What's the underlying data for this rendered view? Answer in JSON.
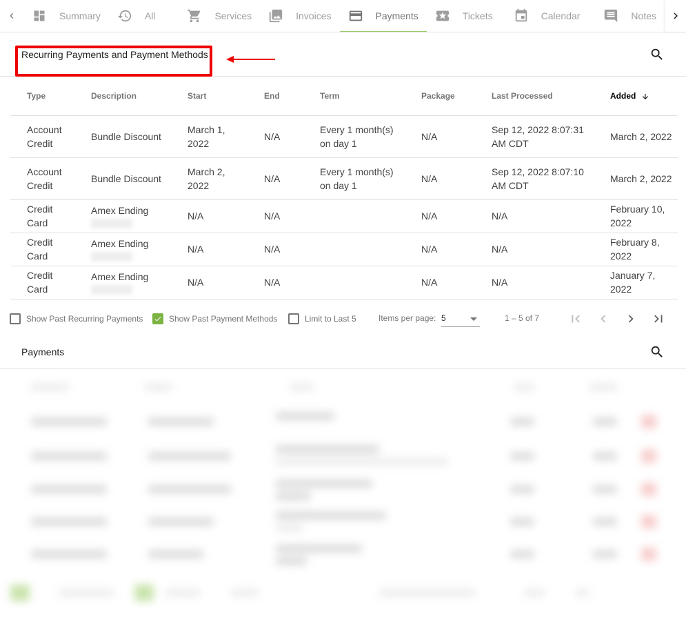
{
  "tabs": {
    "prev_label": "previous-tabs",
    "next_label": "next-tabs",
    "items": [
      {
        "label": "Summary",
        "icon": "dashboard-icon",
        "active": false
      },
      {
        "label": "All",
        "icon": "history-icon",
        "active": false
      },
      {
        "label": "Services",
        "icon": "cart-icon",
        "active": false
      },
      {
        "label": "Invoices",
        "icon": "photo-library-icon",
        "active": false
      },
      {
        "label": "Payments",
        "icon": "credit-card-icon",
        "active": true
      },
      {
        "label": "Tickets",
        "icon": "ticket-star-icon",
        "active": false
      },
      {
        "label": "Calendar",
        "icon": "calendar-icon",
        "active": false
      },
      {
        "label": "Notes",
        "icon": "comment-icon",
        "active": false
      }
    ]
  },
  "recurring": {
    "title": "Recurring Payments and Payment Methods",
    "columns": [
      "Type",
      "Description",
      "Start",
      "End",
      "Term",
      "Package",
      "Last Processed",
      "Added"
    ],
    "sorted_column": "Added",
    "sort_direction": "descending",
    "rows": [
      {
        "type": "Account Credit",
        "description": "Bundle Discount",
        "start": "March 1, 2022",
        "end": "N/A",
        "term": "Every 1 month(s) on day 1",
        "package": "N/A",
        "last_processed": "Sep 12, 2022 8:07:31 AM CDT",
        "added": "March 2, 2022"
      },
      {
        "type": "Account Credit",
        "description": "Bundle Discount",
        "start": "March 2, 2022",
        "end": "N/A",
        "term": "Every 1 month(s) on day 1",
        "package": "N/A",
        "last_processed": "Sep 12, 2022 8:07:10 AM CDT",
        "added": "March 2, 2022"
      },
      {
        "type": "Credit Card",
        "description": "Amex Ending",
        "start": "N/A",
        "end": "N/A",
        "term": "",
        "package": "N/A",
        "last_processed": "N/A",
        "added": "February 10, 2022"
      },
      {
        "type": "Credit Card",
        "description": "Amex Ending",
        "start": "N/A",
        "end": "N/A",
        "term": "",
        "package": "N/A",
        "last_processed": "N/A",
        "added": "February 8, 2022"
      },
      {
        "type": "Credit Card",
        "description": "Amex Ending",
        "start": "N/A",
        "end": "N/A",
        "term": "",
        "package": "N/A",
        "last_processed": "N/A",
        "added": "January 7, 2022"
      }
    ],
    "filters": [
      {
        "label": "Show Past Recurring Payments",
        "checked": false
      },
      {
        "label": "Show Past Payment Methods",
        "checked": true
      },
      {
        "label": "Limit to Last 5",
        "checked": false
      }
    ],
    "paginator": {
      "items_per_page_label": "Items per page:",
      "items_per_page": "5",
      "range_label": "1 – 5 of 7"
    }
  },
  "payments": {
    "title": "Payments"
  },
  "colors": {
    "accent_green": "#9ccc65",
    "checkbox_green": "#7cb342",
    "annotation_red": "#ee0000"
  }
}
